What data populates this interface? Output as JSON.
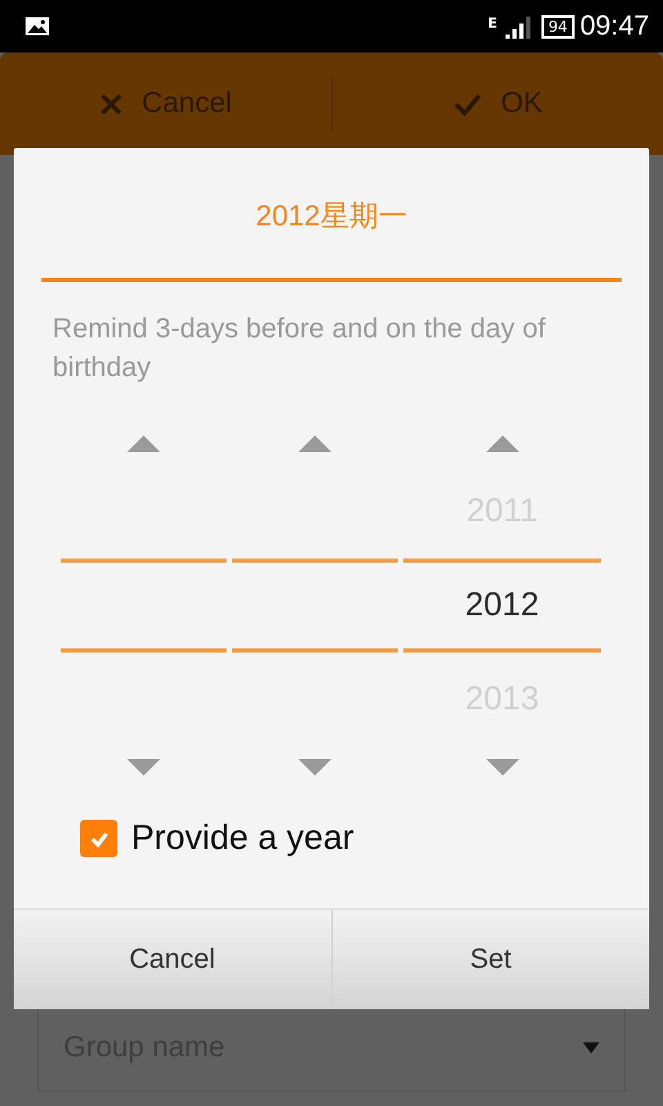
{
  "status_bar": {
    "time": "09:47",
    "battery": "94",
    "network": "E"
  },
  "action_bar": {
    "cancel": "Cancel",
    "ok": "OK"
  },
  "group_field": {
    "placeholder": "Group name"
  },
  "dialog": {
    "title": "2012星期一",
    "hint": "Remind 3-days before and on the day of birthday",
    "columns": [
      {
        "kind": "blank"
      },
      {
        "kind": "blank"
      },
      {
        "kind": "year",
        "prev": "2011",
        "current": "2012",
        "next": "2013"
      }
    ],
    "provide_year": {
      "label": "Provide a year",
      "checked": true
    },
    "buttons": [
      "Cancel",
      "Set"
    ]
  }
}
